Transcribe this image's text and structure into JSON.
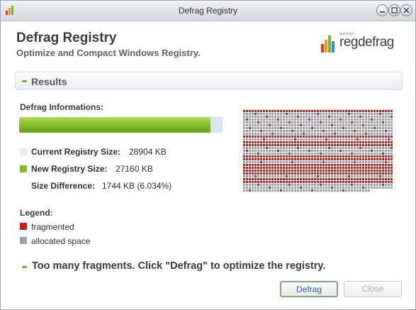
{
  "window": {
    "title": "Defrag Registry"
  },
  "header": {
    "title": "Defrag Registry",
    "subtitle": "Optimize and Compact Windows Registry.",
    "logo": {
      "small_text": "quicksys'",
      "word": "regdefrag"
    }
  },
  "results": {
    "section_title": "Results",
    "info_label": "Defrag Informations:",
    "progress_fraction": 0.94,
    "stats": [
      {
        "label": "Current Registry Size:",
        "value": "28904 KB",
        "swatch_color": "#e9ecef"
      },
      {
        "label": "New Registry Size:",
        "value": "27160 KB",
        "swatch_color": "#7fbf2a"
      },
      {
        "label": "Size Difference:",
        "value": "1744 KB (6.034%)",
        "swatch_color": null
      }
    ]
  },
  "legend": {
    "title": "Legend:",
    "items": [
      {
        "label": "fragmented",
        "color": "#d01a14"
      },
      {
        "label": "allocated space",
        "color": "#9aa1a9"
      }
    ]
  },
  "message": "Too many fragments. Click \"Defrag\" to optimize the registry.",
  "buttons": {
    "defrag": "Defrag",
    "close": "Close"
  },
  "colors": {
    "accent_green": "#66b32e",
    "fragmented": "#d01a14",
    "allocated": "#9aa1a9"
  }
}
